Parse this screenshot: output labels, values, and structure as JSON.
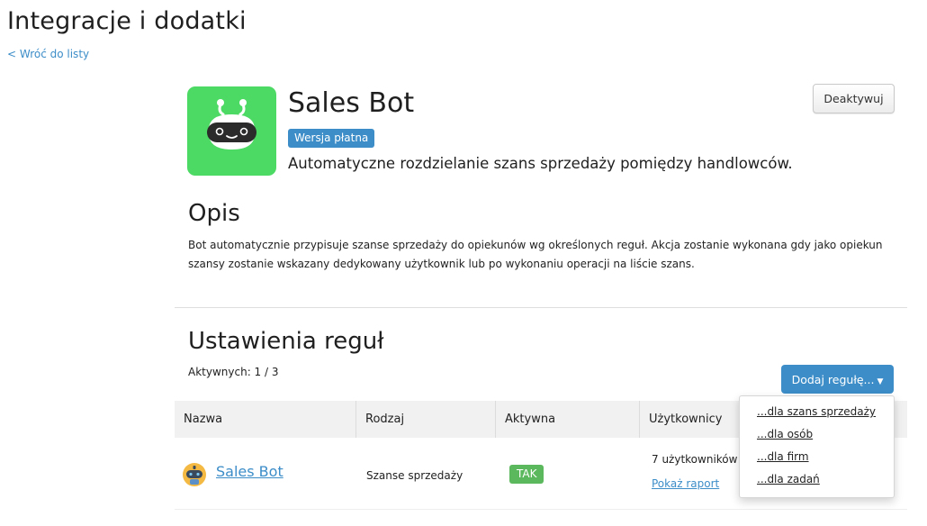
{
  "header": {
    "title": "Integracje i dodatki",
    "back_link": "< Wróć do listy"
  },
  "app": {
    "name": "Sales Bot",
    "badge": "Wersja płatna",
    "tagline": "Automatyczne rozdzielanie szans sprzedaży pomiędzy handlowców.",
    "deactivate_label": "Deaktywuj",
    "icon": "robot-icon",
    "icon_bg_color": "#4cd964"
  },
  "description": {
    "title": "Opis",
    "text": "Bot automatycznie przypisuje szanse sprzedaży do opiekunów wg określonych reguł. Akcja zostanie wykonana gdy jako opiekun szansy zostanie wskazany dedykowany użytkownik lub po wykonaniu operacji na liście szans."
  },
  "rules": {
    "title": "Ustawienia reguł",
    "active_count": "Aktywnych: 1 / 3",
    "add_rule_label": "Dodaj regułę...",
    "add_rule_menu": [
      "...dla szans sprzedaży",
      "...dla osób",
      "...dla firm",
      "...dla zadań"
    ],
    "columns": [
      "Nazwa",
      "Rodzaj",
      "Aktywna",
      "Użytkownicy"
    ],
    "rows": [
      {
        "name": "Sales Bot",
        "type": "Szanse sprzedaży",
        "active": "TAK",
        "users": "7 użytkowników",
        "report_link": "Pokaż raport"
      }
    ]
  },
  "colors": {
    "accent": "#3c8dc8",
    "success": "#5cb85c"
  }
}
